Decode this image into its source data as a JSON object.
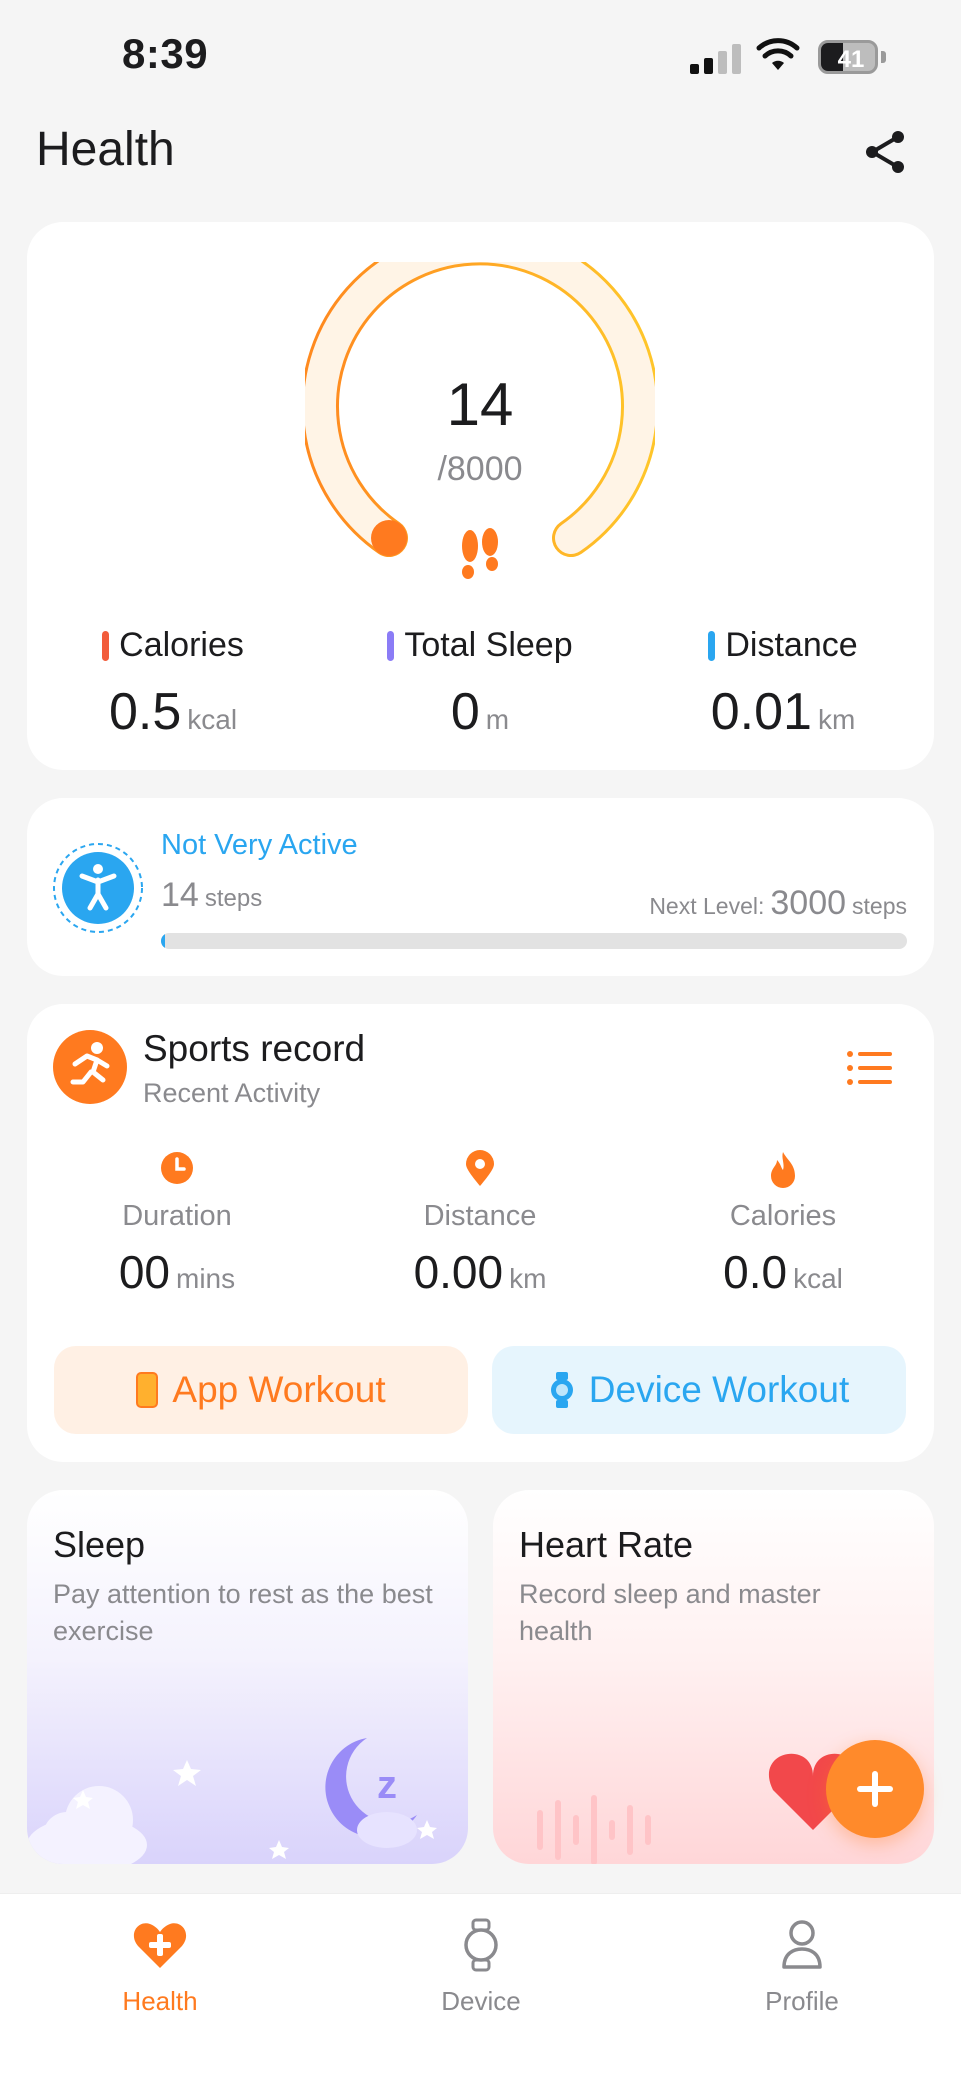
{
  "status_bar": {
    "time": "8:39",
    "battery_level": "41",
    "battery_fraction": 0.41
  },
  "header": {
    "title": "Health"
  },
  "steps": {
    "current": "14",
    "goal": "/8000",
    "progress_fraction": 0.00175,
    "colors": {
      "ring_start": "#ff8a1f",
      "ring_end": "#ffc52a",
      "track": "#fff4e6"
    }
  },
  "daily_metrics": [
    {
      "label": "Calories",
      "value": "0.5",
      "unit": "kcal",
      "color": "#f25c3b"
    },
    {
      "label": "Total Sleep",
      "value": "0",
      "unit": "m",
      "color": "#8b7cf6"
    },
    {
      "label": "Distance",
      "value": "0.01",
      "unit": "km",
      "color": "#2aa6f0"
    }
  ],
  "activity": {
    "level": "Not Very Active",
    "steps_value": "14",
    "steps_unit": "steps",
    "next_level_label": "Next Level:",
    "next_level_value": "3000",
    "next_level_unit": "steps",
    "progress_fraction": 0.005
  },
  "sports": {
    "title": "Sports record",
    "subtitle": "Recent Activity",
    "stats": [
      {
        "icon": "clock-icon",
        "label": "Duration",
        "value": "00",
        "unit": "mins"
      },
      {
        "icon": "location-pin-icon",
        "label": "Distance",
        "value": "0.00",
        "unit": "km"
      },
      {
        "icon": "flame-icon",
        "label": "Calories",
        "value": "0.0",
        "unit": "kcal"
      }
    ],
    "app_workout_label": "App Workout",
    "device_workout_label": "Device Workout"
  },
  "tiles": {
    "sleep": {
      "title": "Sleep",
      "description": "Pay attention to rest as the best exercise"
    },
    "heart": {
      "title": "Heart Rate",
      "description": "Record sleep and master health"
    }
  },
  "tabbar": [
    {
      "label": "Health",
      "icon": "heart-plus-icon",
      "active": true
    },
    {
      "label": "Device",
      "icon": "watch-icon",
      "active": false
    },
    {
      "label": "Profile",
      "icon": "person-icon",
      "active": false
    }
  ],
  "accent_color": "#ff7a1f"
}
